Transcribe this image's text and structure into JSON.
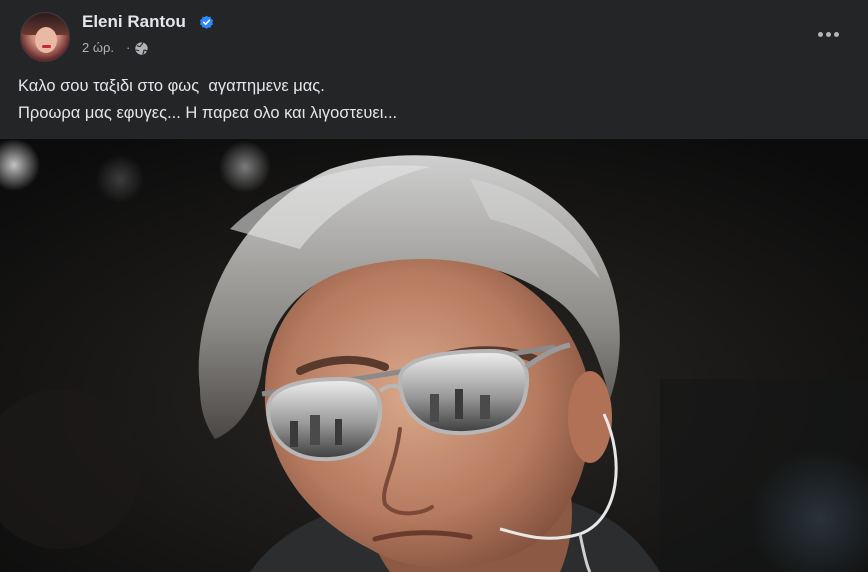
{
  "post": {
    "author": {
      "name": "Eleni Rantou",
      "verified": true,
      "avatar_icon": "profile-avatar"
    },
    "timestamp": "2 ώρ.",
    "audience_icon": "globe-icon",
    "more_icon": "more-horizontal-icon",
    "text_lines": [
      "Καλο σου ταξιδι στο φως  αγαπημενε μας.",
      "Προωρα μας εφυγες... Η παρεα ολο και λιγοστευει..."
    ],
    "photo": {
      "subject": "grey-haired man wearing mirrored aviator sunglasses and a headset microphone"
    }
  },
  "colors": {
    "background": "#242526",
    "primary_text": "#e4e6eb",
    "secondary_text": "#b0b3b8",
    "verified_badge": "#2d88ff"
  }
}
